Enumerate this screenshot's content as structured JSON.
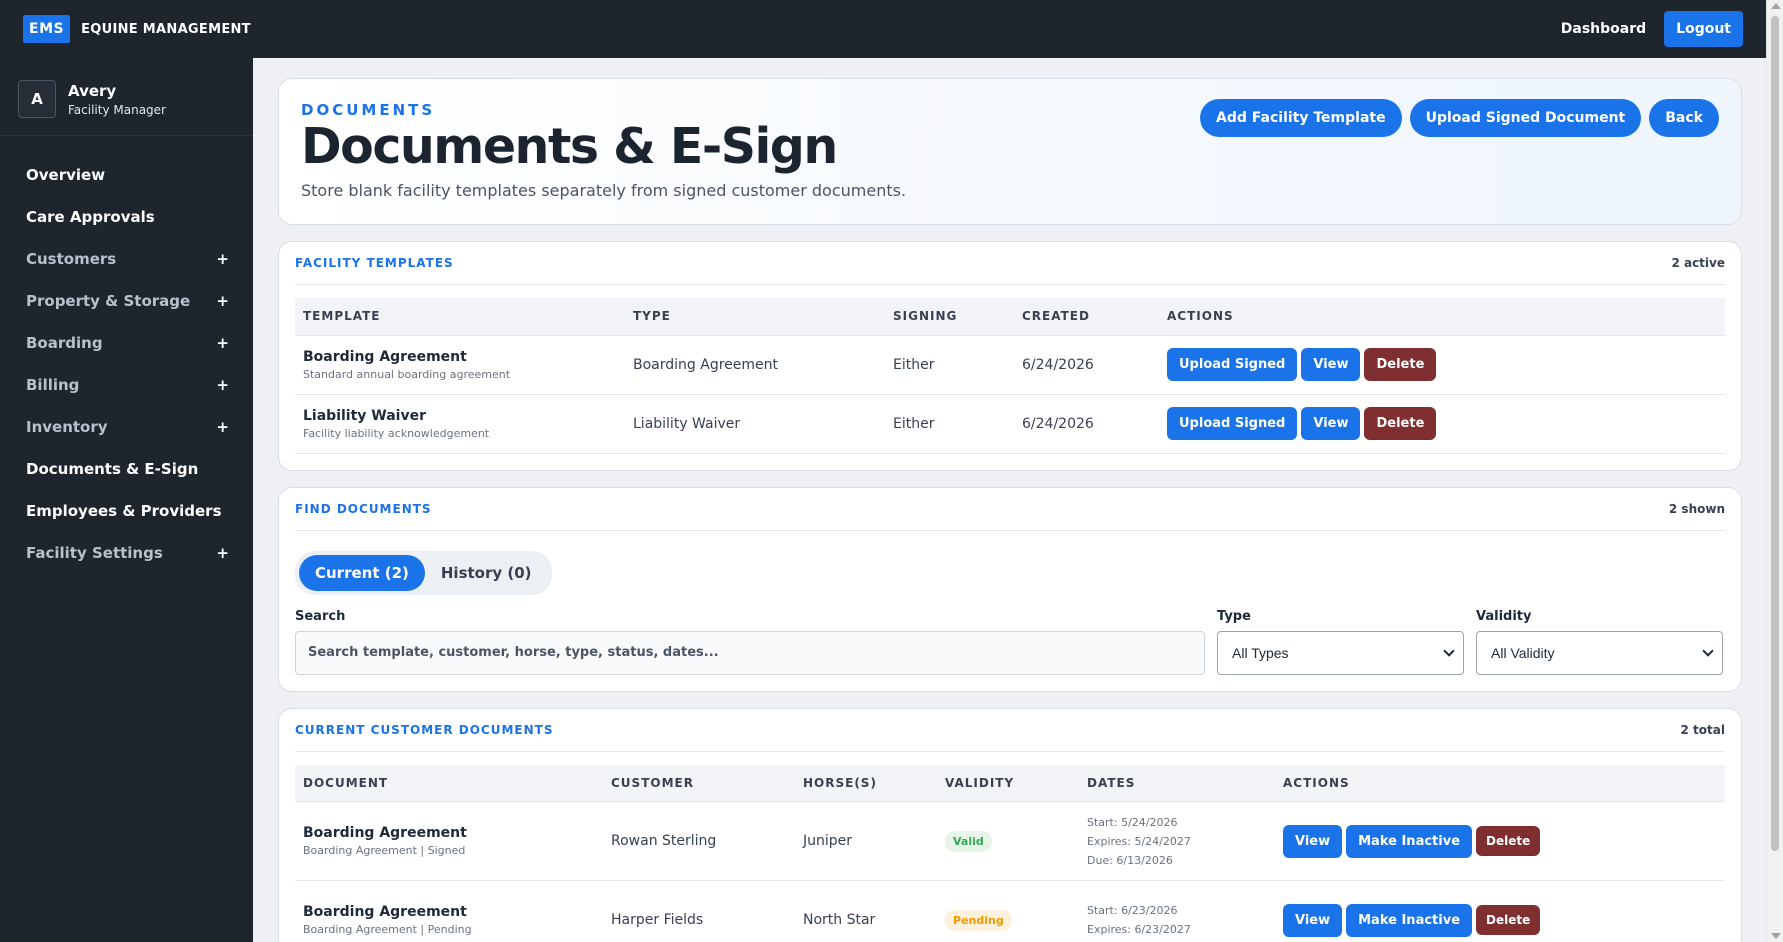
{
  "topbar": {
    "logo": "EMS",
    "brand": "EQUINE MANAGEMENT",
    "dashboard": "Dashboard",
    "logout": "Logout"
  },
  "user": {
    "initial": "A",
    "name": "Avery",
    "role": "Facility Manager"
  },
  "sidebar": {
    "items": [
      {
        "label": "Overview",
        "expandable": false
      },
      {
        "label": "Care Approvals",
        "expandable": false
      },
      {
        "label": "Customers",
        "expandable": true
      },
      {
        "label": "Property & Storage",
        "expandable": true
      },
      {
        "label": "Boarding",
        "expandable": true
      },
      {
        "label": "Billing",
        "expandable": true
      },
      {
        "label": "Inventory",
        "expandable": true
      },
      {
        "label": "Documents & E-Sign",
        "expandable": false
      },
      {
        "label": "Employees & Providers",
        "expandable": false
      },
      {
        "label": "Facility Settings",
        "expandable": true
      }
    ],
    "plus": "+"
  },
  "hero": {
    "kicker": "DOCUMENTS",
    "title": "Documents & E-Sign",
    "subtitle": "Store blank facility templates separately from signed customer documents.",
    "actions": [
      "Add Facility Template",
      "Upload Signed Document",
      "Back"
    ]
  },
  "templates": {
    "title": "FACILITY TEMPLATES",
    "count": "2 active",
    "columns": [
      "TEMPLATE",
      "TYPE",
      "SIGNING",
      "CREATED",
      "ACTIONS"
    ],
    "rows": [
      {
        "name": "Boarding Agreement",
        "desc": "Standard annual boarding agreement",
        "type": "Boarding Agreement",
        "signing": "Either",
        "created": "6/24/2026"
      },
      {
        "name": "Liability Waiver",
        "desc": "Facility liability acknowledgement",
        "type": "Liability Waiver",
        "signing": "Either",
        "created": "6/24/2026"
      }
    ],
    "btn_upload": "Upload Signed",
    "btn_view": "View",
    "btn_delete": "Delete"
  },
  "find": {
    "title": "FIND DOCUMENTS",
    "count": "2 shown",
    "tab_current": "Current (2)",
    "tab_history": "History (0)",
    "search_label": "Search",
    "search_placeholder": "Search template, customer, horse, type, status, dates...",
    "type_label": "Type",
    "type_value": "All Types",
    "validity_label": "Validity",
    "validity_value": "All Validity"
  },
  "current": {
    "title": "CURRENT CUSTOMER DOCUMENTS",
    "count": "2 total",
    "columns": [
      "DOCUMENT",
      "CUSTOMER",
      "HORSE(S)",
      "VALIDITY",
      "DATES",
      "ACTIONS"
    ],
    "rows": [
      {
        "name": "Boarding Agreement",
        "desc": "Boarding Agreement | Signed",
        "customer": "Rowan Sterling",
        "horse": "Juniper",
        "validity": "Valid",
        "start": "Start: 5/24/2026",
        "expires": "Expires: 5/24/2027",
        "due": "Due: 6/13/2026"
      },
      {
        "name": "Boarding Agreement",
        "desc": "Boarding Agreement | Pending",
        "customer": "Harper Fields",
        "horse": "North Star",
        "validity": "Pending",
        "start": "Start: 6/23/2026",
        "expires": "Expires: 6/23/2027",
        "due": ""
      }
    ],
    "btn_view": "View",
    "btn_inactive": "Make Inactive",
    "btn_delete": "Delete"
  }
}
